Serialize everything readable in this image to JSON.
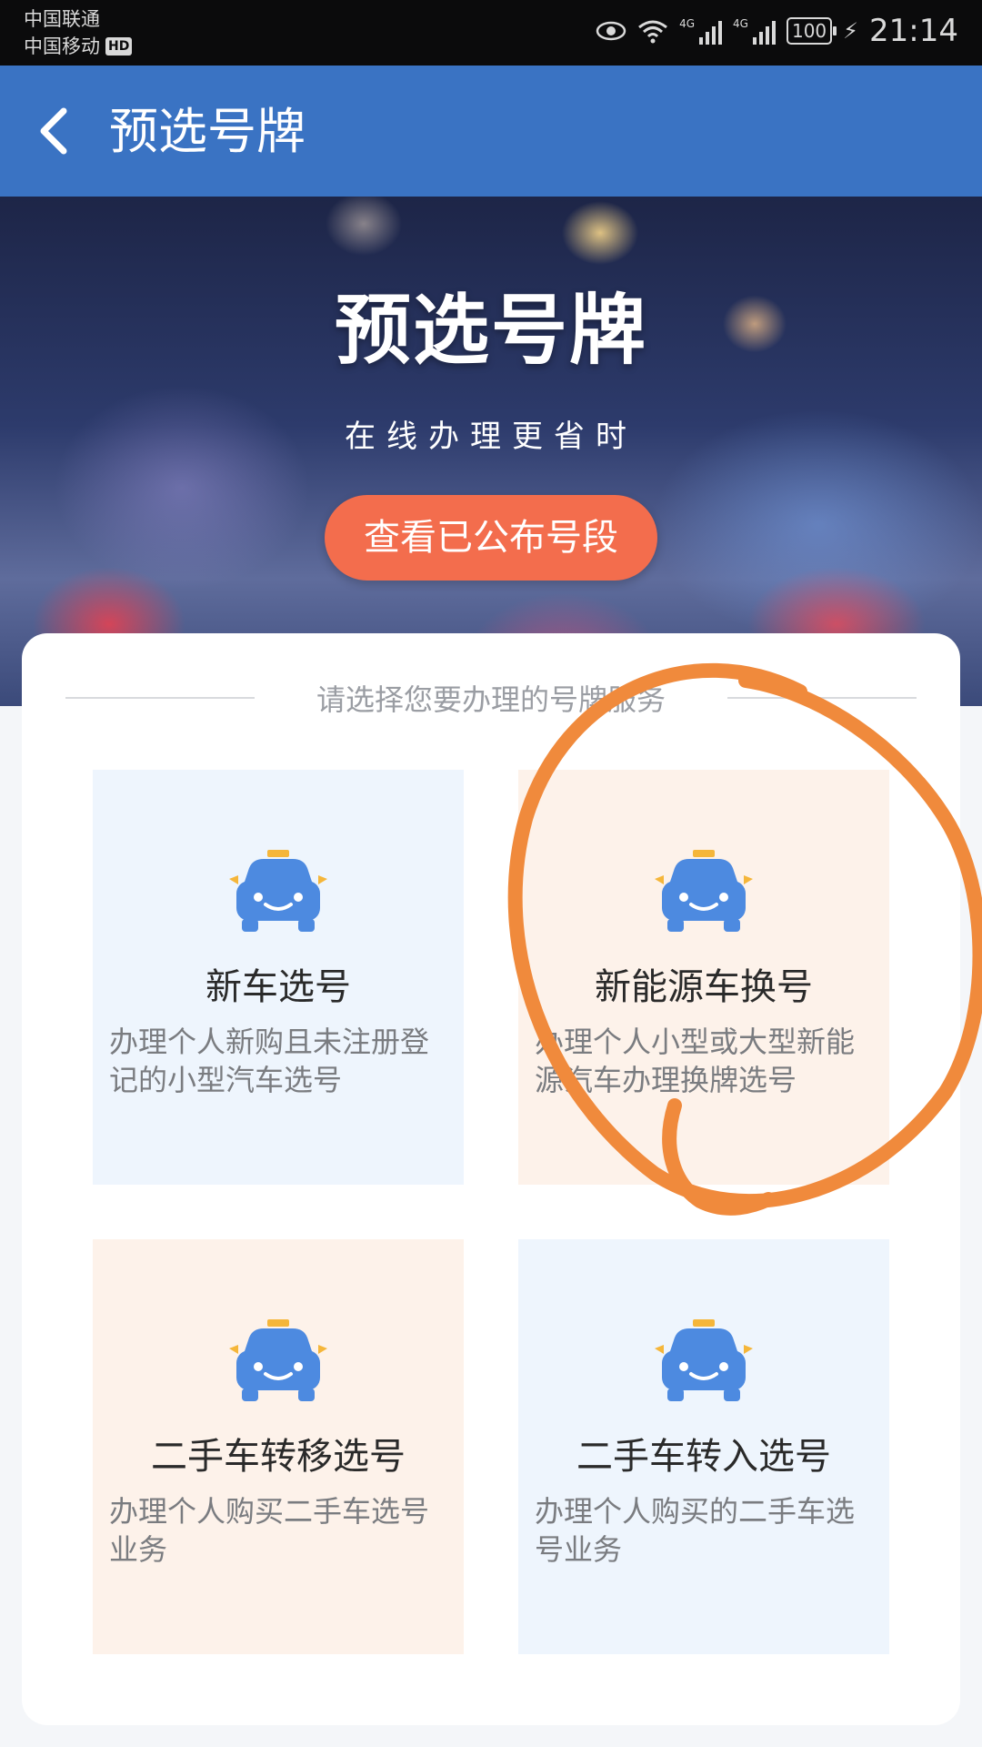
{
  "status_bar": {
    "carrier_1": "中国联通",
    "carrier_2": "中国移动",
    "hd_badge": "HD",
    "network_1": "4G",
    "network_2": "4G",
    "battery": "100",
    "time": "21:14"
  },
  "app_bar": {
    "title": "预选号牌"
  },
  "hero": {
    "title": "预选号牌",
    "subtitle": "在线办理更省时",
    "button_label": "查看已公布号段"
  },
  "services": {
    "section_title": "请选择您要办理的号牌服务",
    "items": [
      {
        "title": "新车选号",
        "description": "办理个人新购且未注册登记的小型汽车选号",
        "tone": "blue"
      },
      {
        "title": "新能源车换号",
        "description": "办理个人小型或大型新能源汽车办理换牌选号",
        "tone": "peach"
      },
      {
        "title": "二手车转移选号",
        "description": "办理个人购买二手车选号业务",
        "tone": "peach"
      },
      {
        "title": "二手车转入选号",
        "description": "办理个人购买的二手车选号业务",
        "tone": "blue"
      }
    ]
  },
  "colors": {
    "app_bar": "#3a73c3",
    "hero_button": "#f36d4d",
    "annotation": "#f08a3c",
    "car_icon": "#4d8ae0",
    "taxi_sign": "#f5b63a"
  },
  "icons": {
    "back": "chevron-left-icon",
    "tile": "taxi-car-icon"
  }
}
